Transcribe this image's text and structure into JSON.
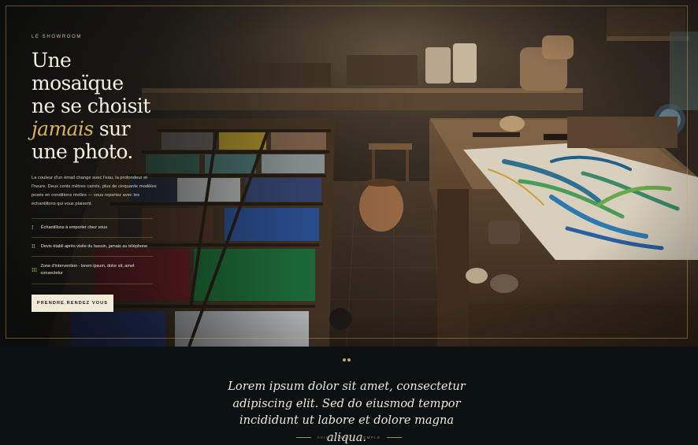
{
  "hero": {
    "eyebrow": "Le showroom",
    "headline": {
      "line1": "Une",
      "line2": "mosaïque",
      "line3": "ne se choisit",
      "line4_accent": "jamais",
      "line4_rest": " sur",
      "line5": "une photo."
    },
    "intro": "La couleur d'un émail change avec l'eau, la profondeur et l'heure. Deux cents mètres carrés, plus de cinquante modèles posés en conditions réelles — vous repartez avec les échantillons qui vous plaisent.",
    "features": [
      {
        "num": "I",
        "text": "Échantillons à emporter chez vous"
      },
      {
        "num": "II",
        "text": "Devis établi après visite du bassin, jamais au téléphone"
      },
      {
        "num": "III",
        "text": "Zone d'intervention · lorem ipsum, dolor sit, amet consectetur"
      }
    ],
    "cta_label": "Prendre rendez vous",
    "background_description_icon": "mosaic-workshop-photo"
  },
  "testimonial": {
    "quote": "Lorem ipsum dolor sit amet, consectetur adipiscing elit. Sed do eiusmod tempor incididunt ut labore et dolore magna aliqua.",
    "attribution": "Avis client · exemple"
  },
  "colors": {
    "background": "#0b1011",
    "gold_accent": "#c9a85a",
    "accent_text": "#d8b25f",
    "cream_button": "#f1ead9",
    "heading_text": "#f5efe2"
  }
}
